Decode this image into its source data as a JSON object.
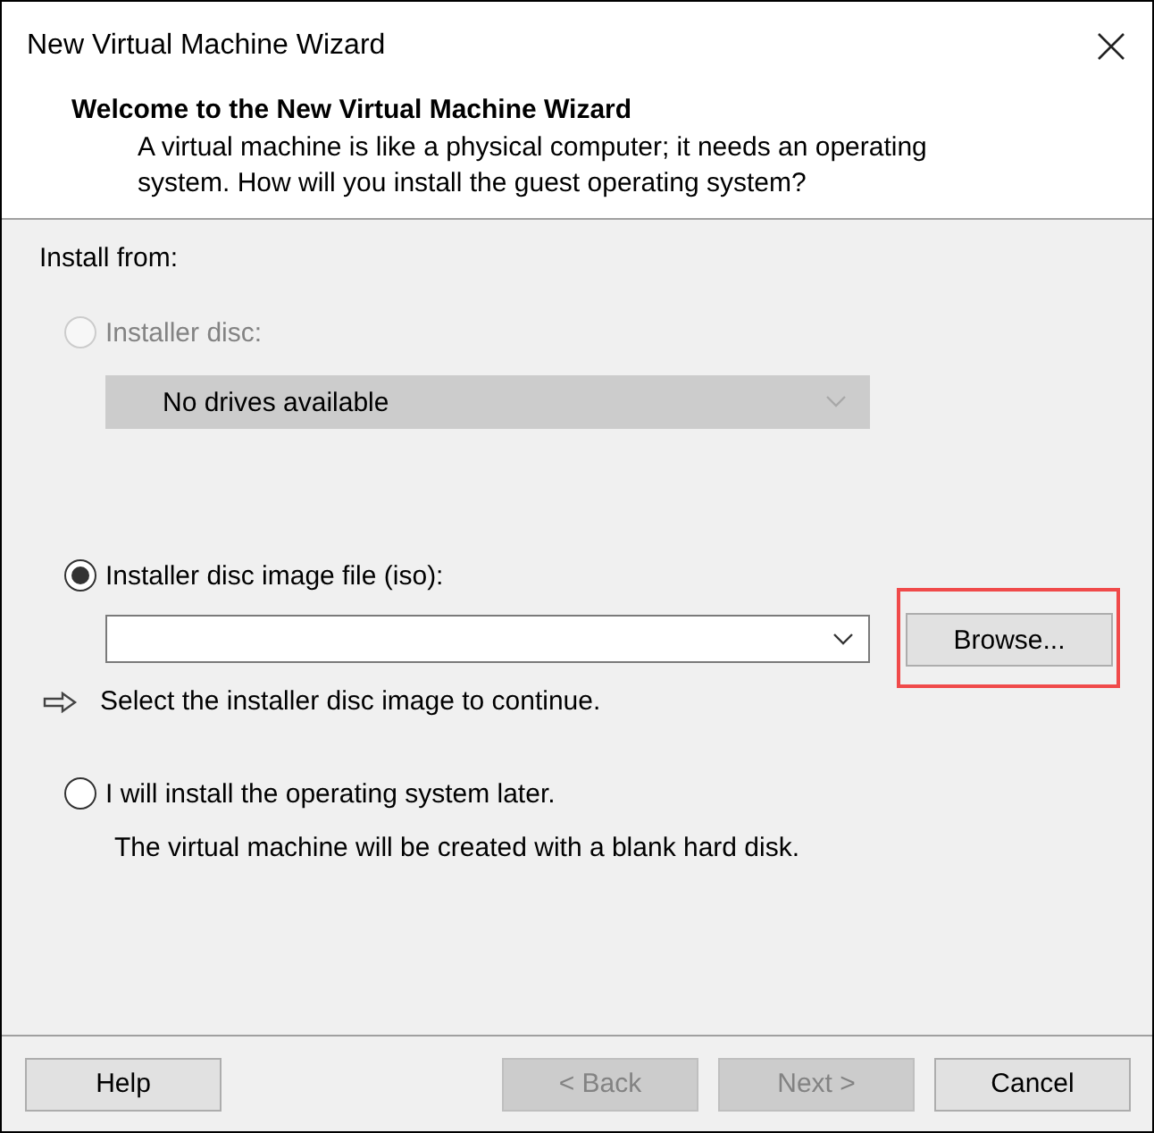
{
  "window": {
    "title": "New Virtual Machine Wizard"
  },
  "header": {
    "heading": "Welcome to the New Virtual Machine Wizard",
    "description": "A virtual machine is like a physical computer; it needs an operating system. How will you install the guest operating system?"
  },
  "install_from": {
    "label": "Install from:",
    "options": [
      {
        "kind": "disc",
        "label": "Installer disc:",
        "selected": false,
        "disabled": true,
        "dropdown": {
          "value": "No drives available",
          "disabled": true
        }
      },
      {
        "kind": "iso",
        "label": "Installer disc image file (iso):",
        "selected": true,
        "disabled": false,
        "browse_button": {
          "label": "Browse...",
          "highlighted": true
        },
        "hint": "Select the installer disc image to continue."
      },
      {
        "kind": "later",
        "label": "I will install the operating system later.",
        "selected": false,
        "disabled": false,
        "note": "The virtual machine will be created with a blank hard disk."
      }
    ]
  },
  "buttons": [
    {
      "label": "Help",
      "disabled": false
    },
    {
      "label": "< Back",
      "disabled": true
    },
    {
      "label": "Next >",
      "disabled": true
    },
    {
      "label": "Cancel",
      "disabled": false
    }
  ]
}
